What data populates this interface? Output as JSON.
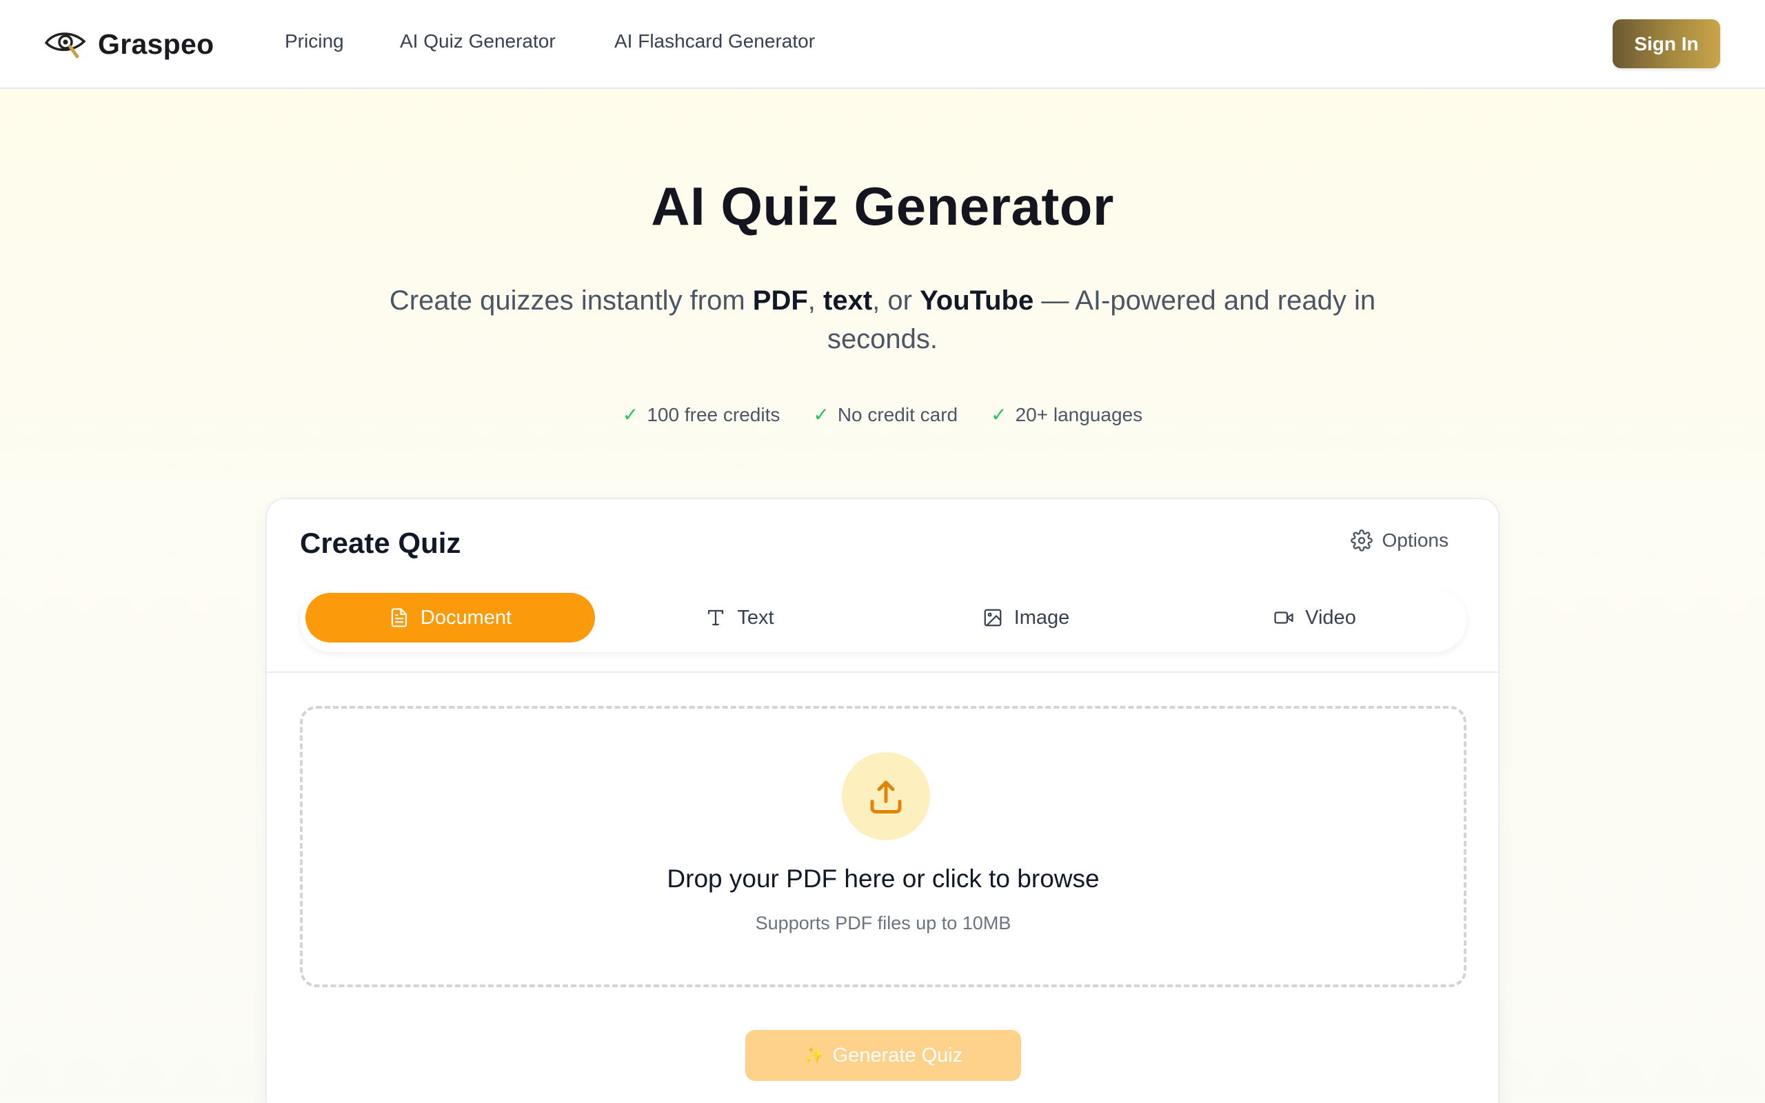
{
  "header": {
    "brand": "Graspeo",
    "nav": [
      "Pricing",
      "AI Quiz Generator",
      "AI Flashcard Generator"
    ],
    "signin_label": "Sign In"
  },
  "hero": {
    "title": "AI Quiz Generator",
    "subtitle": {
      "p1": "Create quizzes instantly from ",
      "b1": "PDF",
      "p2": ", ",
      "b2": "text",
      "p3": ", or ",
      "b3": "YouTube",
      "p4": " — AI-powered and ready in seconds."
    },
    "badges": [
      "100 free credits",
      "No credit card",
      "20+ languages"
    ]
  },
  "card": {
    "title": "Create Quiz",
    "options_label": "Options",
    "tabs": [
      {
        "label": "Document",
        "icon": "document-icon",
        "active": true
      },
      {
        "label": "Text",
        "icon": "text-icon",
        "active": false
      },
      {
        "label": "Image",
        "icon": "image-icon",
        "active": false
      },
      {
        "label": "Video",
        "icon": "video-icon",
        "active": false
      }
    ],
    "dropzone": {
      "title": "Drop your PDF here or click to browse",
      "subtitle": "Supports PDF files up to 10MB",
      "icon": "upload-icon"
    },
    "generate_label": "Generate Quiz"
  },
  "colors": {
    "accent": "#fb9a0b",
    "signin_gradient_start": "#6b5a32",
    "signin_gradient_end": "#c9a54a",
    "check": "#22c55e",
    "generate_disabled": "#fed28b"
  }
}
